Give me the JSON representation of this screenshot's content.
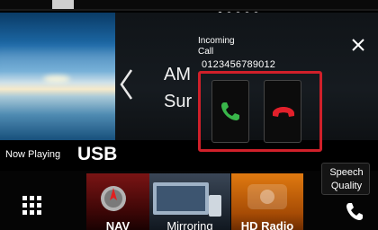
{
  "status": {
    "page_dots": 5,
    "active_page": 1
  },
  "source_panel": {
    "line1": "AM",
    "line2": "Sur"
  },
  "now_playing": {
    "label": "Now Playing",
    "source": "USB"
  },
  "incoming_call": {
    "title_line1": "Incoming",
    "title_line2": "Call",
    "number": "0123456789012",
    "answer_icon": "phone-answer-icon",
    "reject_icon": "phone-reject-icon",
    "answer_color": "#39b54a",
    "reject_color": "#e2202b",
    "highlight_color": "#d0202a"
  },
  "speech_quality": {
    "line1": "Speech",
    "line2": "Quality"
  },
  "dock": {
    "menu_icon": "grid-menu-icon",
    "items": [
      {
        "label": "NAV",
        "icon": "nav-icon"
      },
      {
        "label": "Mirroring",
        "icon": "mirroring-icon"
      },
      {
        "label": "HD Radio",
        "icon": "hd-radio-icon"
      }
    ],
    "phone_icon": "phone-icon"
  }
}
